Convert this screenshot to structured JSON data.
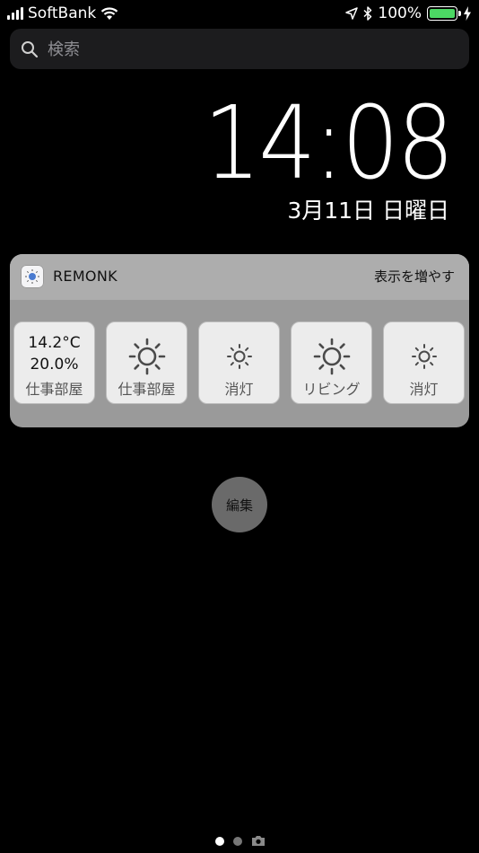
{
  "status_bar": {
    "carrier": "SoftBank",
    "battery_percent": "100%",
    "battery_level": 1.0,
    "icons": [
      "signal-icon",
      "wifi-icon",
      "location-icon",
      "bluetooth-icon",
      "battery-icon",
      "charging-icon"
    ]
  },
  "search": {
    "placeholder": "検索",
    "value": ""
  },
  "lock": {
    "time": "14:08",
    "date": "3月11日 日曜日"
  },
  "widget": {
    "app_name": "REMONK",
    "show_more": "表示を増やす",
    "tiles": [
      {
        "type": "sensor",
        "temperature": "14.2°C",
        "humidity": "20.0%",
        "label": "仕事部屋"
      },
      {
        "type": "light",
        "icon": "sun-large-icon",
        "label": "仕事部屋"
      },
      {
        "type": "light",
        "icon": "sun-small-icon",
        "label": "消灯"
      },
      {
        "type": "light",
        "icon": "sun-large-icon",
        "label": "リビング"
      },
      {
        "type": "light",
        "icon": "sun-small-icon",
        "label": "消灯"
      }
    ]
  },
  "edit_button": {
    "label": "編集"
  },
  "pager": {
    "pages": [
      "today",
      "home",
      "camera"
    ],
    "active_index": 0
  },
  "colors": {
    "background": "#000000",
    "battery_fill": "#4cd964",
    "widget_header": "#adadad",
    "widget_body": "#9a9a9a",
    "tile": "#ececec"
  }
}
